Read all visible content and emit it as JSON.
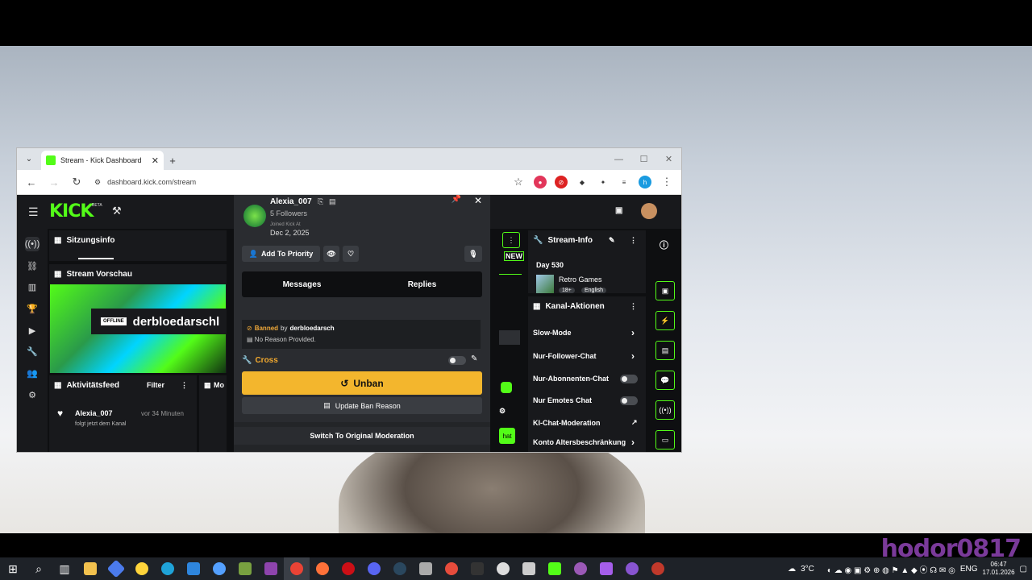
{
  "browser": {
    "tab_title": "Stream - Kick Dashboard",
    "url": "dashboard.kick.com/stream"
  },
  "kick": {
    "logo": "KICK",
    "logo_beta": "BETA",
    "session_info": "Sitzungsinfo",
    "stream_preview": "Stream Vorschau",
    "offline": "OFFLINE",
    "channel_name": "derbloedarschl",
    "activity_feed": "Aktivitätsfeed",
    "filter": "Filter",
    "feed_user": "Alexia_007",
    "feed_time": "vor 34 Minuten",
    "feed_action": "folgt jetzt dem Kanal",
    "mo_tab": "Mo",
    "new_badge": "NEW",
    "chat_btn": "hat"
  },
  "modal": {
    "username": "Alexia_007",
    "followers": "5 Followers",
    "joined_label": "Joined Kick At",
    "joined_date": "Dec 2, 2025",
    "add_priority": "Add To Priority",
    "tabs": [
      "Messages",
      "Replies"
    ],
    "banned_word": "Banned",
    "banned_by": "by",
    "banned_mod": "derbloedarsch",
    "no_reason": "No Reason Provided.",
    "cross": "Cross",
    "unban": "Unban",
    "update_ban": "Update Ban Reason",
    "switch_mod": "Switch To Original Moderation"
  },
  "stream_info": {
    "title": "Stream-Info",
    "day": "Day 530",
    "category": "Retro Games",
    "tags": [
      "18+",
      "English"
    ]
  },
  "channel_actions": {
    "title": "Kanal-Aktionen",
    "items": [
      "Slow-Mode",
      "Nur-Follower-Chat",
      "Nur-Abonnenten-Chat",
      "Nur Emotes Chat",
      "KI-Chat-Moderation",
      "Konto Altersbeschränkung"
    ]
  },
  "taskbar": {
    "weather": "3°C",
    "lang": "ENG",
    "time": "06:47",
    "date": "17.01.2026"
  },
  "watermark": "hodor0817",
  "colors": {
    "kick_green": "#53fc18",
    "unban_yellow": "#f3b62d",
    "banned_orange": "#f0a93a"
  }
}
